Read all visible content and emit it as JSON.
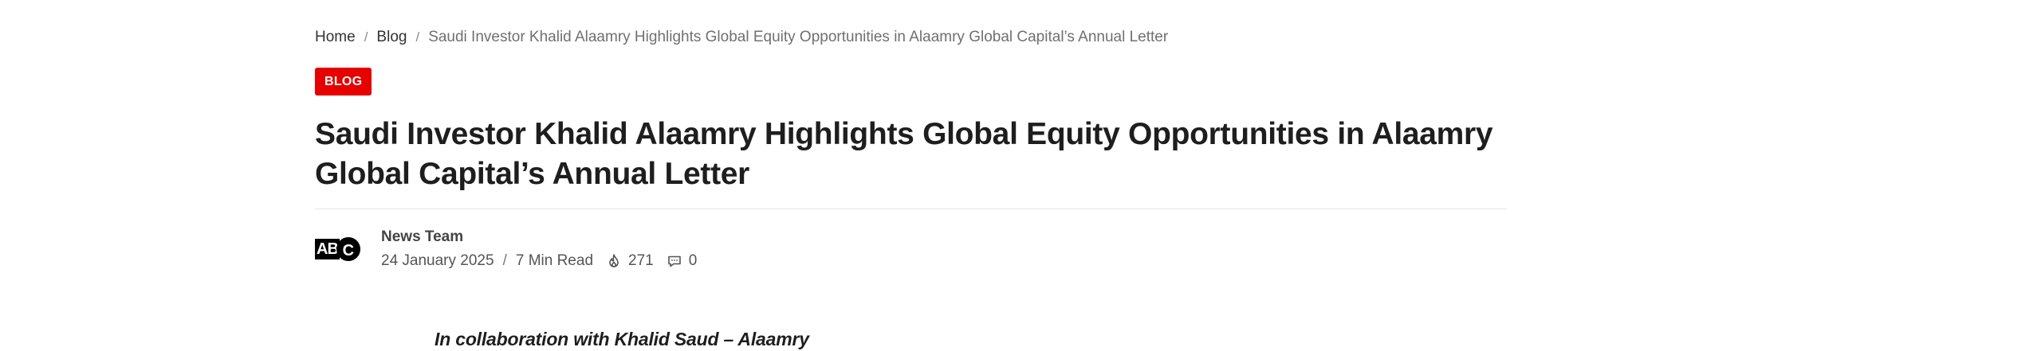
{
  "breadcrumb": {
    "home": "Home",
    "separator": "/",
    "blog": "Blog",
    "current": "Saudi Investor Khalid Alaamry Highlights Global Equity Opportunities in Alaamry Global Capital’s Annual Letter"
  },
  "category_badge": "BLOG",
  "article": {
    "title": "Saudi Investor Khalid Alaamry Highlights Global Equity Opportunities in Alaamry Global Capital’s Annual Letter",
    "author": "News Team",
    "logo_text_box": "AB",
    "logo_text_circle": "C",
    "date": "24 January 2025",
    "meta_separator": "/",
    "read_time": "7 Min Read",
    "views": "271",
    "comments": "0",
    "intro": "In collaboration with Khalid Saud – Alaamry"
  },
  "icons": {
    "views": "flame-icon",
    "comments": "comment-bubble-icon"
  },
  "colors": {
    "badge_bg": "#e60000",
    "badge_text": "#ffffff",
    "title": "#1e1e1e"
  }
}
